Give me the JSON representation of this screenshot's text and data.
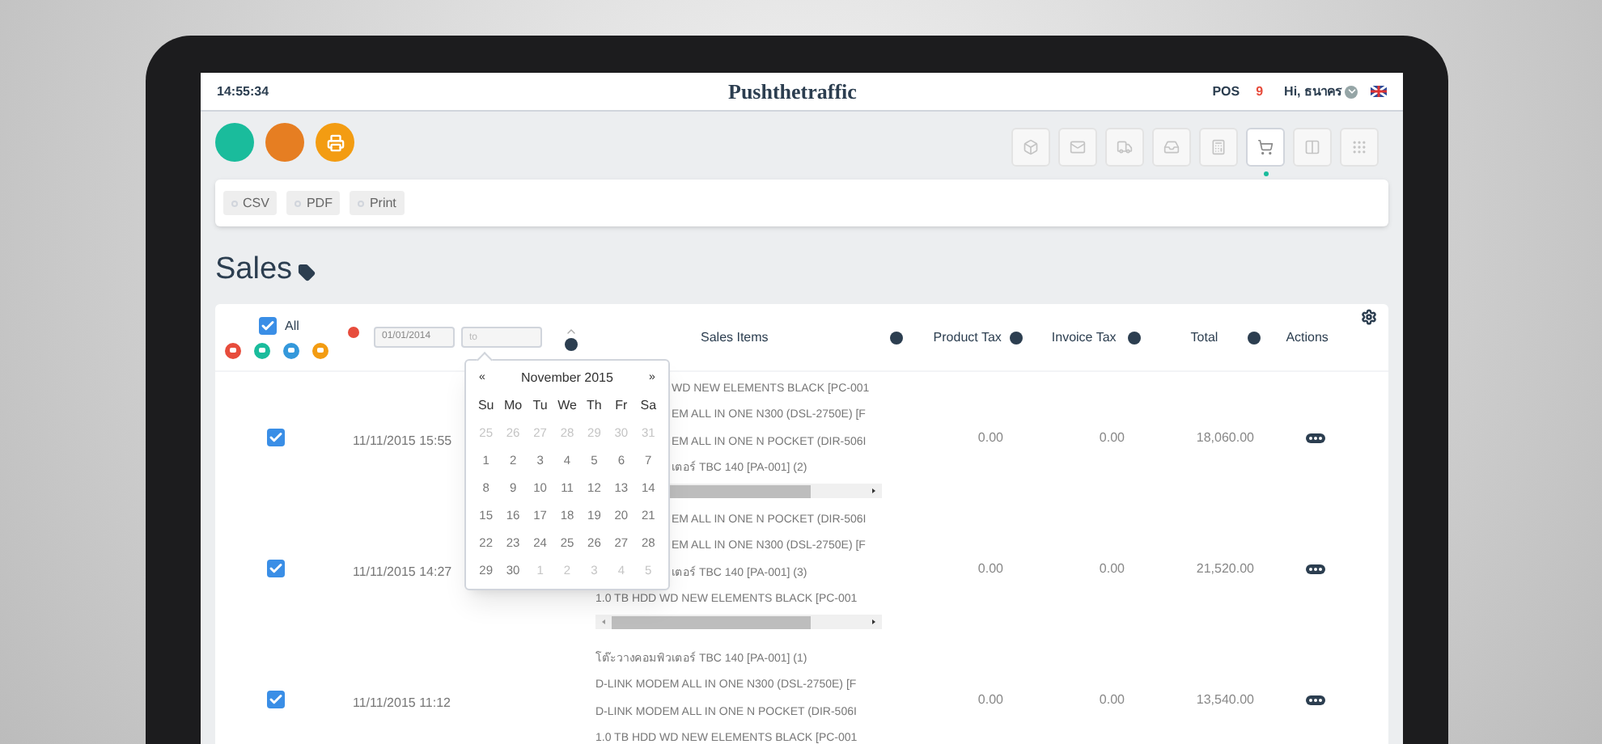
{
  "top_bar": {
    "time": "14:55:34",
    "title": "Pushthetraffic",
    "pos_label": "POS",
    "pos_number": "9",
    "greeting": "Hi, ธนาคร"
  },
  "quick_actions": [
    {
      "color": "#1abc9c"
    },
    {
      "color": "#e67e22"
    },
    {
      "color": "#f39c12"
    }
  ],
  "toolbar": [
    {
      "selected": false
    },
    {
      "selected": false
    },
    {
      "selected": false
    },
    {
      "selected": false
    },
    {
      "selected": false
    },
    {
      "selected": true
    },
    {
      "selected": false
    },
    {
      "selected": false
    }
  ],
  "export_buttons": [
    "CSV",
    "PDF",
    "Print"
  ],
  "page_title": "Sales",
  "table": {
    "header": {
      "select_all": {
        "label": "All",
        "checked": true
      },
      "status_filters": [
        {
          "color": "#e74c3c"
        },
        {
          "color": "#1abc9c"
        },
        {
          "color": "#3498db"
        },
        {
          "color": "#f39c12"
        }
      ],
      "date_from": {
        "value": "01/01/2014"
      },
      "date_to": {
        "placeholder": "to"
      },
      "columns": [
        "Sales Items",
        "Product Tax",
        "Invoice Tax",
        "Total",
        "Actions"
      ]
    },
    "rows": [
      {
        "checked": true,
        "date": "11/11/2015 15:55",
        "items": [
          {
            "kind": "partial",
            "text": "WD NEW ELEMENTS BLACK [PC-001"
          },
          {
            "kind": "partial",
            "text": "EM ALL IN ONE N300 (DSL-2750E) [F"
          },
          {
            "kind": "partial",
            "text": "EM ALL IN ONE N POCKET (DIR-506I"
          },
          {
            "kind": "partial",
            "text": "เตอร์ TBC 140 [PA-001] (2)"
          }
        ],
        "scrollbar": true,
        "product_tax": "0.00",
        "invoice_tax": "0.00",
        "total": "18,060.00"
      },
      {
        "checked": true,
        "date": "11/11/2015 14:27",
        "items": [
          {
            "kind": "partial",
            "text": "EM ALL IN ONE N POCKET (DIR-506I"
          },
          {
            "kind": "partial",
            "text": "EM ALL IN ONE N300 (DSL-2750E) [F"
          },
          {
            "kind": "partial",
            "text": "เตอร์ TBC 140 [PA-001] (3)"
          },
          {
            "kind": "full",
            "text": "1.0 TB HDD WD NEW ELEMENTS BLACK [PC-001"
          }
        ],
        "scrollbar": true,
        "product_tax": "0.00",
        "invoice_tax": "0.00",
        "total": "21,520.00"
      },
      {
        "checked": true,
        "date": "11/11/2015 11:12",
        "items": [
          {
            "kind": "full",
            "text": "โต๊ะวางคอมพิวเตอร์ TBC 140 [PA-001] (1)"
          },
          {
            "kind": "full",
            "text": "D-LINK MODEM ALL IN ONE N300 (DSL-2750E) [F"
          },
          {
            "kind": "full",
            "text": "D-LINK MODEM ALL IN ONE N POCKET (DIR-506I"
          },
          {
            "kind": "full",
            "text": "1.0 TB HDD WD NEW ELEMENTS BLACK [PC-001"
          }
        ],
        "scrollbar": false,
        "product_tax": "0.00",
        "invoice_tax": "0.00",
        "total": "13,540.00"
      }
    ]
  },
  "calendar": {
    "prev": "«",
    "month": "November 2015",
    "next": "»",
    "weekdays": [
      "Su",
      "Mo",
      "Tu",
      "We",
      "Th",
      "Fr",
      "Sa"
    ],
    "weeks": [
      [
        {
          "day": "25",
          "outside": true
        },
        {
          "day": "26",
          "outside": true
        },
        {
          "day": "27",
          "outside": true
        },
        {
          "day": "28",
          "outside": true
        },
        {
          "day": "29",
          "outside": true
        },
        {
          "day": "30",
          "outside": true
        },
        {
          "day": "31",
          "outside": true
        }
      ],
      [
        {
          "day": "1",
          "outside": false
        },
        {
          "day": "2",
          "outside": false
        },
        {
          "day": "3",
          "outside": false
        },
        {
          "day": "4",
          "outside": false
        },
        {
          "day": "5",
          "outside": false
        },
        {
          "day": "6",
          "outside": false
        },
        {
          "day": "7",
          "outside": false
        }
      ],
      [
        {
          "day": "8",
          "outside": false
        },
        {
          "day": "9",
          "outside": false
        },
        {
          "day": "10",
          "outside": false
        },
        {
          "day": "11",
          "outside": false
        },
        {
          "day": "12",
          "outside": false
        },
        {
          "day": "13",
          "outside": false
        },
        {
          "day": "14",
          "outside": false
        }
      ],
      [
        {
          "day": "15",
          "outside": false
        },
        {
          "day": "16",
          "outside": false
        },
        {
          "day": "17",
          "outside": false
        },
        {
          "day": "18",
          "outside": false
        },
        {
          "day": "19",
          "outside": false
        },
        {
          "day": "20",
          "outside": false
        },
        {
          "day": "21",
          "outside": false
        }
      ],
      [
        {
          "day": "22",
          "outside": false
        },
        {
          "day": "23",
          "outside": false
        },
        {
          "day": "24",
          "outside": false
        },
        {
          "day": "25",
          "outside": false
        },
        {
          "day": "26",
          "outside": false
        },
        {
          "day": "27",
          "outside": false
        },
        {
          "day": "28",
          "outside": false
        }
      ],
      [
        {
          "day": "29",
          "outside": false
        },
        {
          "day": "30",
          "outside": false
        },
        {
          "day": "1",
          "outside": true
        },
        {
          "day": "2",
          "outside": true
        },
        {
          "day": "3",
          "outside": true
        },
        {
          "day": "4",
          "outside": true
        },
        {
          "day": "5",
          "outside": true
        }
      ]
    ]
  }
}
